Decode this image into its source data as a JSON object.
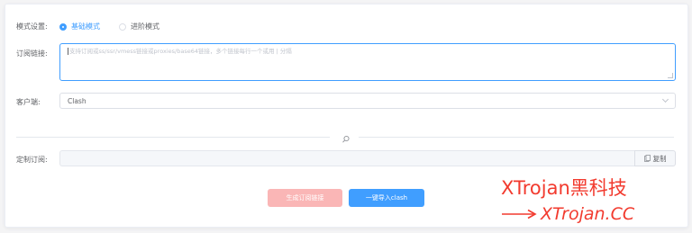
{
  "mode": {
    "label": "模式设置:",
    "options": [
      {
        "label": "基础模式",
        "checked": true
      },
      {
        "label": "进阶模式",
        "checked": false
      }
    ]
  },
  "subscription": {
    "label": "订阅链接:",
    "placeholder": "支持订阅或ss/ssr/vmess链接或proxies/base64链接，多个链接每行一个或用 | 分隔"
  },
  "client": {
    "label": "客户端:",
    "value": "Clash"
  },
  "custom": {
    "label": "定制订阅:",
    "value": "",
    "copy_label": "复制"
  },
  "buttons": {
    "generate": "生成订阅链接",
    "import": "一键导入clash"
  },
  "watermark": {
    "title": "XTrojan黑科技",
    "link": "XTrojan.CC"
  },
  "colors": {
    "primary": "#409eff",
    "danger_disabled": "#fab6b6",
    "watermark": "#f23a2e"
  },
  "icons": {
    "divider": "magic-wand-icon",
    "copy": "copy-icon",
    "dropdown": "chevron-down-icon"
  }
}
